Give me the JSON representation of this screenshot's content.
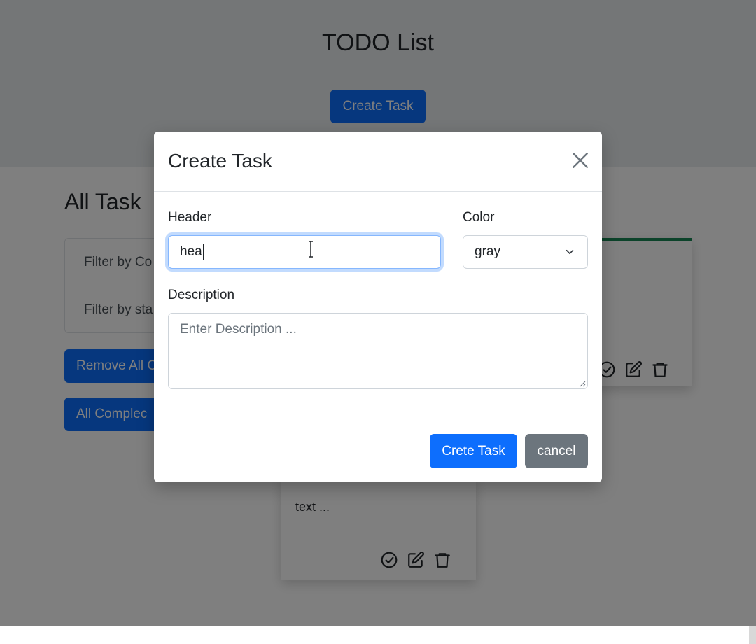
{
  "page": {
    "title": "TODO List",
    "create_button": "Create Task",
    "section_title": "All Task",
    "filters": [
      "Filter by Co",
      "Filter by sta"
    ],
    "remove_button": "Remove All C",
    "complete_button": "All Complec",
    "card_text": "text ..."
  },
  "modal": {
    "title": "Create Task",
    "header_label": "Header",
    "header_value": "hea",
    "color_label": "Color",
    "color_value": "gray",
    "description_label": "Description",
    "description_placeholder": "Enter Description ...",
    "submit_button": "Crete Task",
    "cancel_button": "cancel"
  },
  "colors": {
    "primary": "#0d6efd",
    "secondary": "#6c757d",
    "card_accent": "#198754"
  },
  "icons": [
    "check-circle-icon",
    "edit-icon",
    "trash-icon",
    "close-icon",
    "chevron-down-icon"
  ]
}
